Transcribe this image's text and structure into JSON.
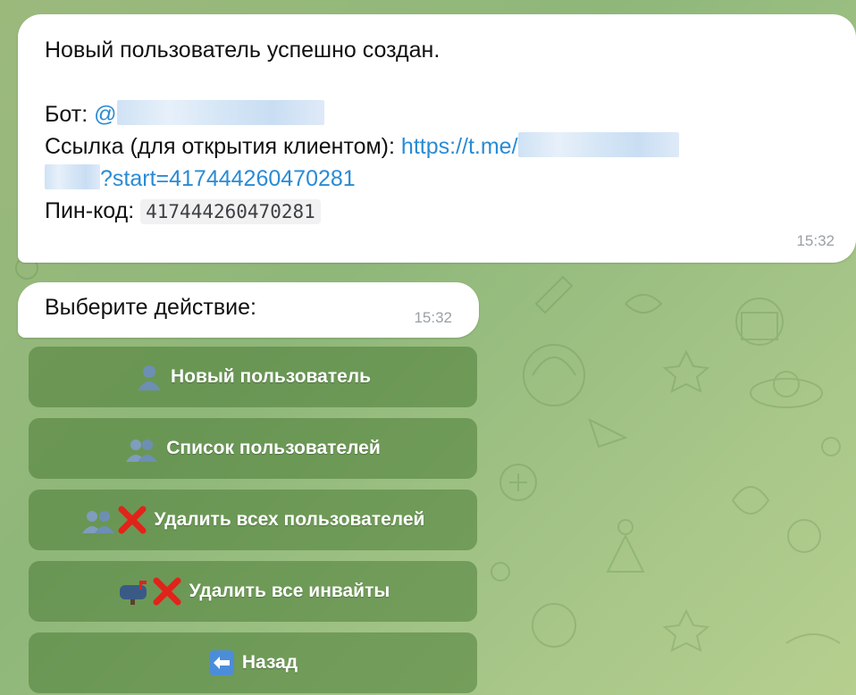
{
  "messages": [
    {
      "line1": "Новый пользователь успешно создан.",
      "bot_label": "Бот:",
      "bot_handle": "@",
      "link_label": "Ссылка (для открытия клиентом):",
      "link_prefix": "https://t.me/",
      "link_suffix": "?start=417444260470281",
      "pin_label": "Пин-код:",
      "pin_code": "417444260470281",
      "time": "15:32"
    },
    {
      "text": "Выберите действие:",
      "time": "15:32"
    }
  ],
  "keyboard": [
    {
      "label": "Новый пользователь",
      "icon": "user-icon"
    },
    {
      "label": "Список пользователей",
      "icon": "users-icon"
    },
    {
      "label": "Удалить всех пользователей",
      "icon": "users-delete-icon"
    },
    {
      "label": "Удалить все инвайты",
      "icon": "mailbox-delete-icon"
    },
    {
      "label": "Назад",
      "icon": "back-arrow-icon"
    }
  ],
  "colors": {
    "link": "#2a8bd4",
    "button_bg": "rgba(70,120,50,0.52)",
    "delete_mark": "#e2231a"
  }
}
